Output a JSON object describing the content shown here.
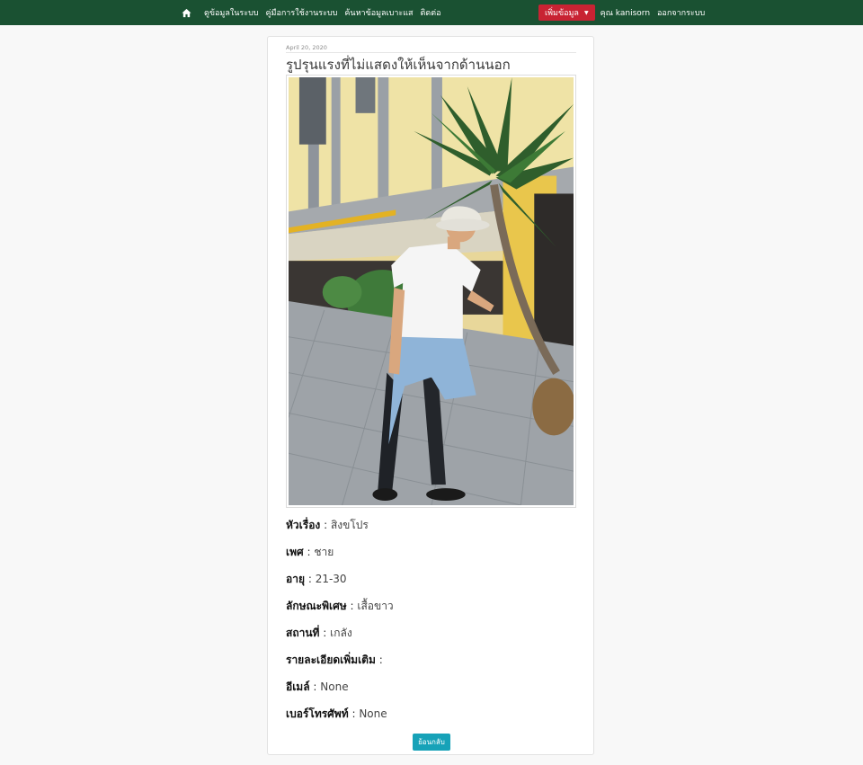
{
  "navbar": {
    "home_icon": "home-icon",
    "links": [
      {
        "label": "ดูข้อมูลในระบบ"
      },
      {
        "label": "คู่มือการใช้งานระบบ"
      },
      {
        "label": "ค้นหาข้อมูลเบาะแส"
      },
      {
        "label": "ติดต่อ"
      }
    ],
    "add_button_label": "เพิ่มข้อมูล",
    "user_label": "คุณ kanisorn",
    "logout_label": "ออกจากระบบ"
  },
  "post": {
    "date": "April 20, 2020",
    "title": "รูปรุนแรงที่ไม่แสดงให้เห็นจากด้านนอก",
    "photo_description": "photo-image",
    "fields": [
      {
        "key": "หัวเรื่อง",
        "value": "สิงขโปร"
      },
      {
        "key": "เพศ",
        "value": "ชาย"
      },
      {
        "key": "อายุ",
        "value": "21-30"
      },
      {
        "key": "ลักษณะพิเศษ",
        "value": "เสื้อขาว"
      },
      {
        "key": "สถานที่",
        "value": "เกลัง"
      },
      {
        "key": "รายละเอียดเพิ่มเติม",
        "value": ""
      },
      {
        "key": "อีเมล์",
        "value": "None"
      },
      {
        "key": "เบอร์โทรศัพท์",
        "value": "None"
      }
    ],
    "separator": ":",
    "back_button_label": "ย้อนกลับ"
  },
  "colors": {
    "navbar_bg": "#1a5132",
    "add_button_bg": "#c82333",
    "back_button_bg": "#17a2b8",
    "page_bg": "#f8f8f8"
  }
}
